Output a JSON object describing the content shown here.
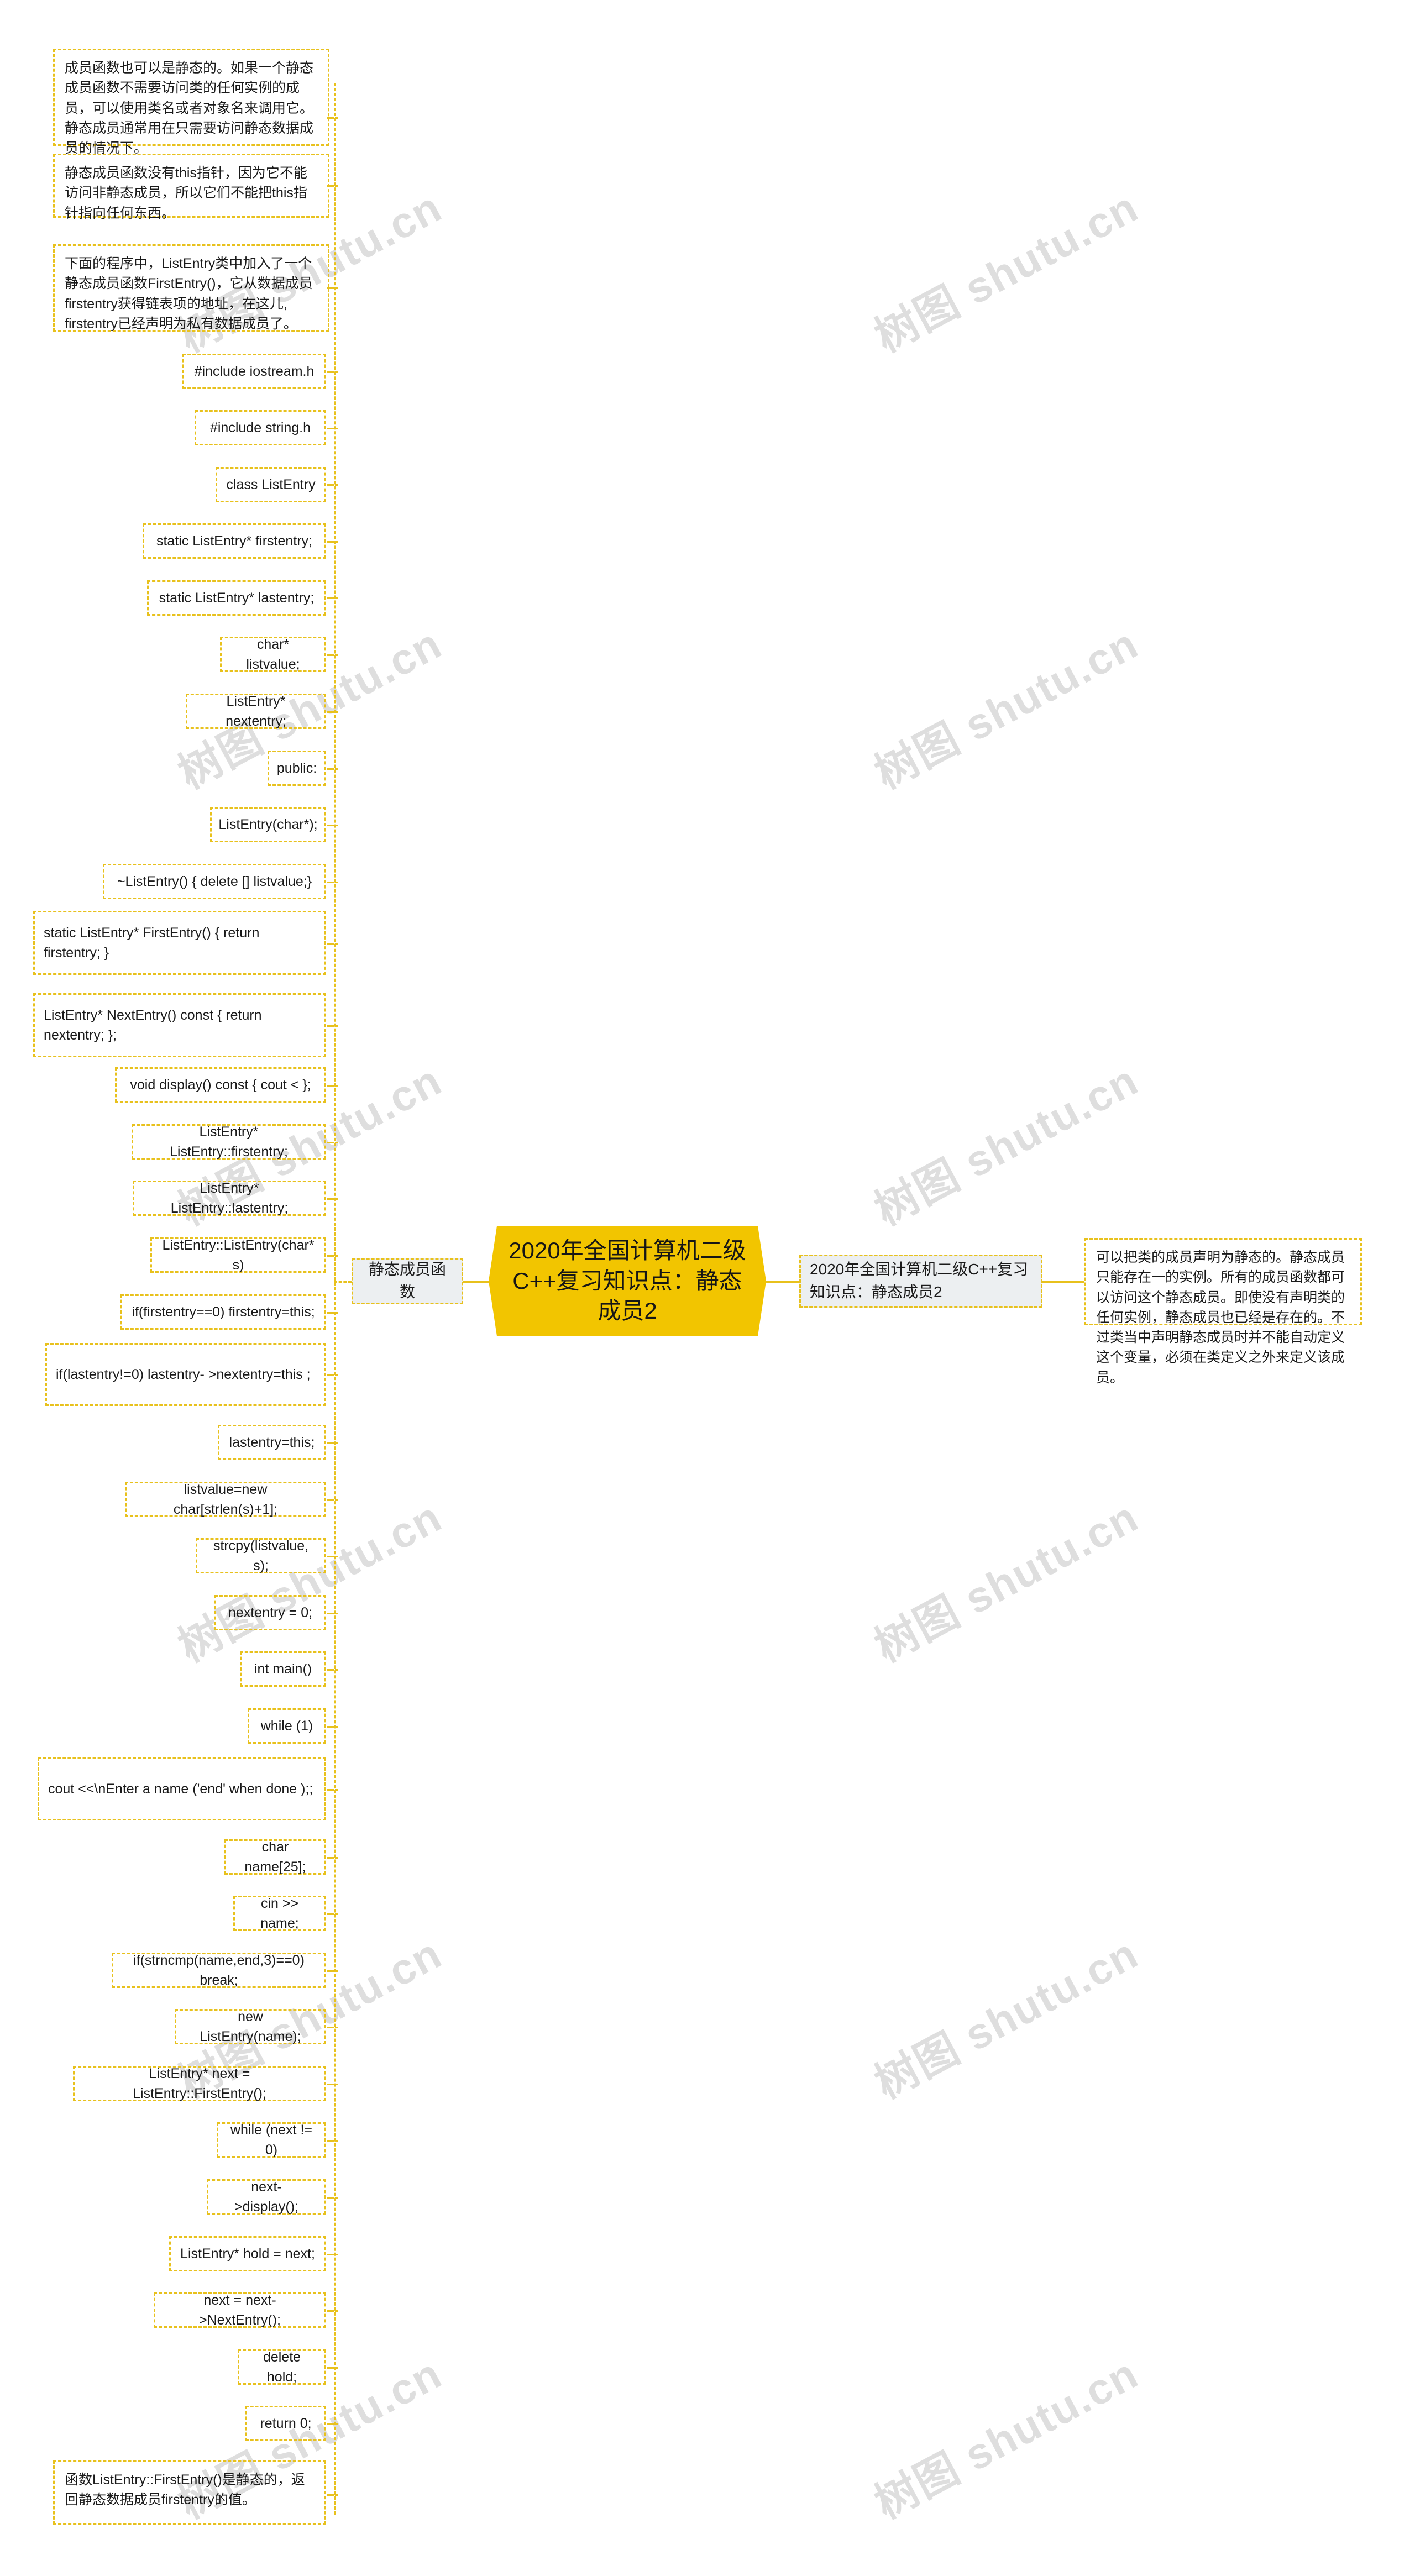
{
  "root": {
    "title": "2020年全国计算机二级C++复习知识点：静态成员2",
    "fill_color": "#f2c500",
    "text_color": "#161616"
  },
  "theme": {
    "border_color": "#e8c11c",
    "node_fill": "#eceff1",
    "page_background": "#ffffff",
    "watermark_text": "树图 shutu.cn",
    "watermark_color": "#d9d9d9"
  },
  "branches": {
    "left_label": "静态成员函数",
    "right_label": "2020年全国计算机二级C++复习知识点：静态成员2"
  },
  "right_detail": "可以把类的成员声明为静态的。静态成员只能存在一的实例。所有的成员函数都可以访问这个静态成员。即使没有声明类的任何实例，静态成员也已经是存在的。不过类当中声明静态成员时并不能自动定义这个变量，必须在类定义之外来定义该成员。",
  "left_nodes": [
    {
      "id": "n1",
      "text": "成员函数也可以是静态的。如果一个静态成员函数不需要访问类的任何实例的成员，可以使用类名或者对象名来调用它。静态成员通常用在只需要访问静态数据成员的情况下。",
      "style": "para"
    },
    {
      "id": "n2",
      "text": "静态成员函数没有this指针，因为它不能访问非静态成员，所以它们不能把this指针指向任何东西。",
      "style": "para"
    },
    {
      "id": "n3",
      "text": "下面的程序中，ListEntry类中加入了一个静态成员函数FirstEntry()，它从数据成员firstentry获得链表项的地址，在这儿, firstentry已经声明为私有数据成员了。",
      "style": "para"
    },
    {
      "id": "n4",
      "text": "#include iostream.h",
      "style": "code"
    },
    {
      "id": "n5",
      "text": "#include string.h",
      "style": "code"
    },
    {
      "id": "n6",
      "text": "class ListEntry",
      "style": "code"
    },
    {
      "id": "n7",
      "text": "static ListEntry* firstentry;",
      "style": "code"
    },
    {
      "id": "n8",
      "text": "static ListEntry* lastentry;",
      "style": "code"
    },
    {
      "id": "n9",
      "text": "char* listvalue;",
      "style": "code"
    },
    {
      "id": "n10",
      "text": "ListEntry* nextentry;",
      "style": "code"
    },
    {
      "id": "n11",
      "text": "public:",
      "style": "code"
    },
    {
      "id": "n12",
      "text": "ListEntry(char*);",
      "style": "code"
    },
    {
      "id": "n13",
      "text": "~ListEntry() { delete [] listvalue;}",
      "style": "code"
    },
    {
      "id": "n14",
      "text": "static ListEntry* FirstEntry() { return firstentry; }",
      "style": "code-left"
    },
    {
      "id": "n15",
      "text": "ListEntry* NextEntry() const { return nextentry; };",
      "style": "code-left"
    },
    {
      "id": "n16",
      "text": "void display() const { cout < };",
      "style": "code"
    },
    {
      "id": "n17",
      "text": "ListEntry* ListEntry::firstentry;",
      "style": "code"
    },
    {
      "id": "n18",
      "text": "ListEntry* ListEntry::lastentry;",
      "style": "code"
    },
    {
      "id": "n19",
      "text": "ListEntry::ListEntry(char* s)",
      "style": "code"
    },
    {
      "id": "n20",
      "text": "if(firstentry==0) firstentry=this;",
      "style": "code"
    },
    {
      "id": "n21",
      "text": "if(lastentry!=0) lastentry- >nextentry=this ;",
      "style": "code-left"
    },
    {
      "id": "n22",
      "text": "lastentry=this;",
      "style": "code"
    },
    {
      "id": "n23",
      "text": "listvalue=new char[strlen(s)+1];",
      "style": "code"
    },
    {
      "id": "n24",
      "text": "strcpy(listvalue, s);",
      "style": "code"
    },
    {
      "id": "n25",
      "text": "nextentry = 0;",
      "style": "code"
    },
    {
      "id": "n26",
      "text": "int main()",
      "style": "code"
    },
    {
      "id": "n27",
      "text": "while (1)",
      "style": "code"
    },
    {
      "id": "n28",
      "text": "cout <<\\nEnter a name ('end' when done );;",
      "style": "code-left"
    },
    {
      "id": "n29",
      "text": "char name[25];",
      "style": "code"
    },
    {
      "id": "n30",
      "text": "cin >> name;",
      "style": "code"
    },
    {
      "id": "n31",
      "text": "if(strncmp(name,end,3)==0) break;",
      "style": "code"
    },
    {
      "id": "n32",
      "text": "new ListEntry(name);",
      "style": "code"
    },
    {
      "id": "n33",
      "text": "ListEntry* next = ListEntry::FirstEntry();",
      "style": "code"
    },
    {
      "id": "n34",
      "text": "while (next != 0)",
      "style": "code"
    },
    {
      "id": "n35",
      "text": "next- >display();",
      "style": "code"
    },
    {
      "id": "n36",
      "text": "ListEntry* hold = next;",
      "style": "code"
    },
    {
      "id": "n37",
      "text": "next = next- >NextEntry();",
      "style": "code"
    },
    {
      "id": "n38",
      "text": "delete hold;",
      "style": "code"
    },
    {
      "id": "n39",
      "text": "return 0;",
      "style": "code"
    },
    {
      "id": "n40",
      "text": "函数ListEntry::FirstEntry()是静态的，返回静态数据成员firstentry的值。",
      "style": "para"
    }
  ]
}
